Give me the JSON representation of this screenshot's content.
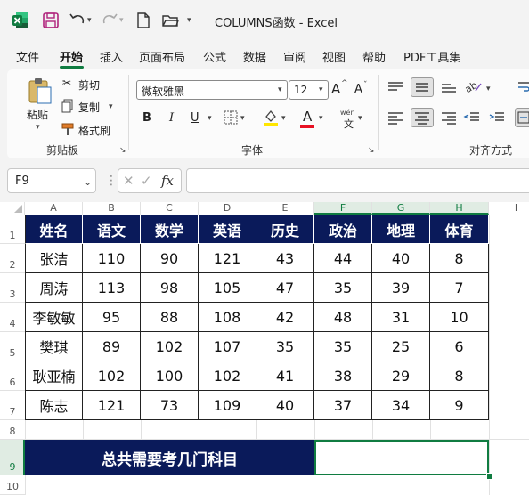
{
  "title": "COLUMNS函数  -  Excel",
  "menu": [
    "文件",
    "开始",
    "插入",
    "页面布局",
    "公式",
    "数据",
    "审阅",
    "视图",
    "帮助",
    "PDF工具集"
  ],
  "ribbon": {
    "paste": "粘贴",
    "cut": "剪切",
    "copy": "复制",
    "format_painter": "格式刷",
    "clipboard_group": "剪贴板",
    "font_name": "微软雅黑",
    "font_size": "12",
    "font_group": "字体",
    "align_group": "对齐方式",
    "bold": "B",
    "italic": "I",
    "underline": "U",
    "font_color_a": "A",
    "grow_a": "A",
    "shrink_a": "A",
    "wen": "wén"
  },
  "formula": {
    "name_box": "F9",
    "fx": "fx",
    "value": ""
  },
  "columns": [
    "A",
    "B",
    "C",
    "D",
    "E",
    "F",
    "G",
    "H",
    "I"
  ],
  "rows": [
    "1",
    "2",
    "3",
    "4",
    "5",
    "6",
    "7",
    "8",
    "9",
    "10"
  ],
  "table": {
    "headers": [
      "姓名",
      "语文",
      "数学",
      "英语",
      "历史",
      "政治",
      "地理",
      "体育"
    ],
    "data": [
      [
        "张洁",
        "110",
        "90",
        "121",
        "43",
        "44",
        "40",
        "8"
      ],
      [
        "周涛",
        "113",
        "98",
        "105",
        "47",
        "35",
        "39",
        "7"
      ],
      [
        "李敏敏",
        "95",
        "88",
        "108",
        "42",
        "48",
        "31",
        "10"
      ],
      [
        "樊琪",
        "89",
        "102",
        "107",
        "35",
        "35",
        "25",
        "6"
      ],
      [
        "耿亚楠",
        "102",
        "100",
        "102",
        "41",
        "38",
        "29",
        "8"
      ],
      [
        "陈志",
        "121",
        "73",
        "109",
        "40",
        "37",
        "34",
        "9"
      ]
    ]
  },
  "banner": "总共需要考几门科目",
  "colors": {
    "header_bg": "#0a1a5a",
    "accent": "#107c41"
  }
}
